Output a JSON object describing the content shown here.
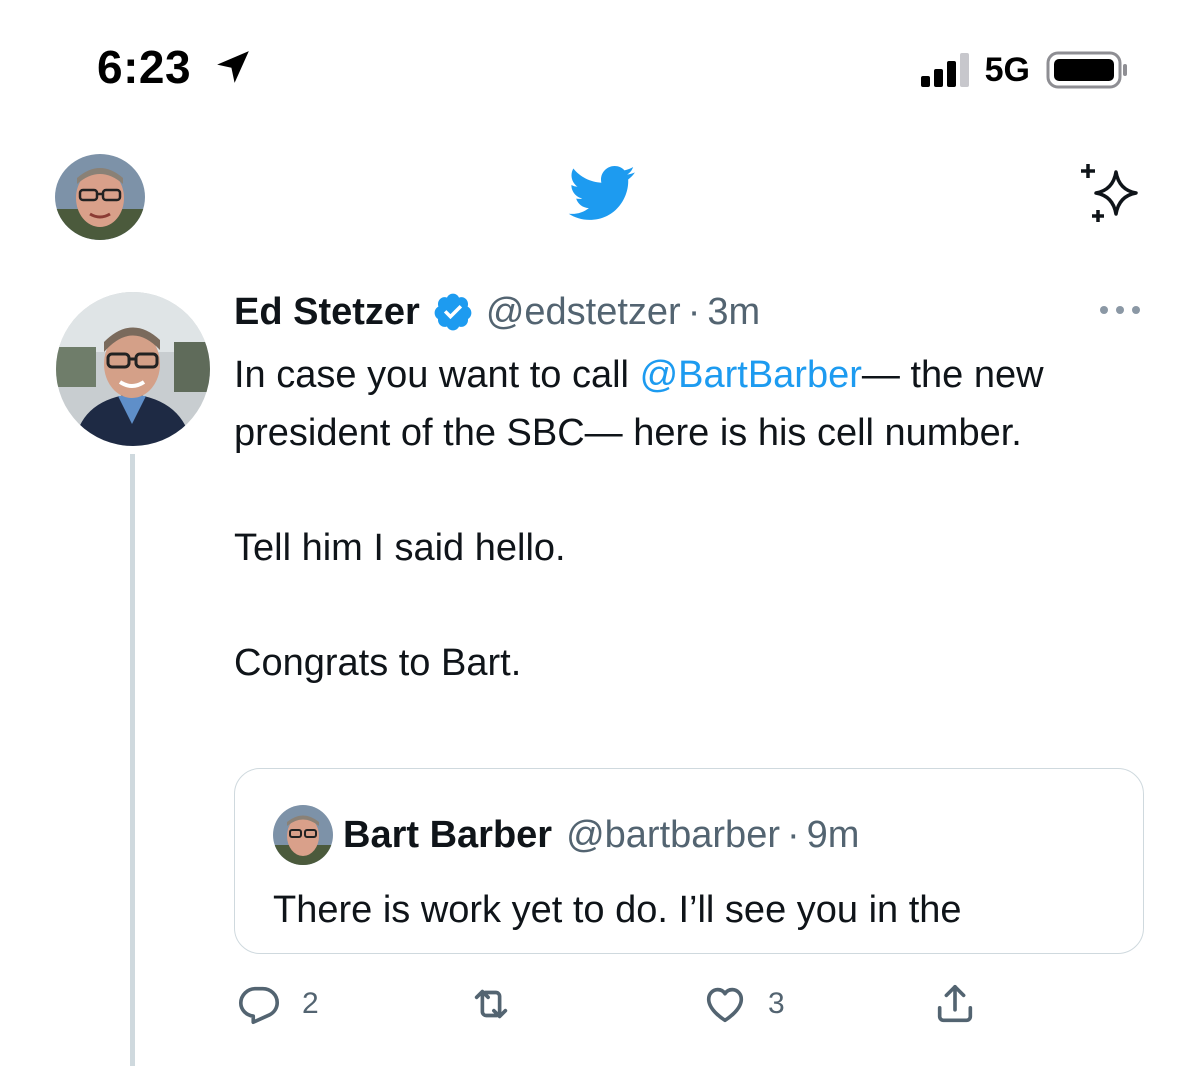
{
  "status_bar": {
    "time": "6:23",
    "network": "5G",
    "icons": [
      "location-arrow-icon",
      "signal-icon",
      "battery-icon"
    ]
  },
  "nav": {
    "icons": [
      "profile-avatar",
      "twitter-bird-icon",
      "sparkle-icon"
    ],
    "accent": "#1d9bf0"
  },
  "tweet": {
    "author_name": "Ed Stetzer",
    "handle": "@edstetzer",
    "separator": "·",
    "time": "3m",
    "text_line1_before": "In case you want to call ",
    "mention": "@BartBarber",
    "text_line1_after": "— the new president of the SBC— here is his cell number.",
    "text_para2": "Tell him I said hello.",
    "text_para3": "Congrats to Bart.",
    "quoted": {
      "author_name": "Bart Barber",
      "handle": "@bartbarber",
      "separator": "·",
      "time": "9m",
      "text": "There is work yet to do. I’ll see you in the"
    },
    "actions": {
      "reply_count": "2",
      "retweet_count": "",
      "like_count": "3"
    }
  },
  "colors": {
    "accent": "#1d9bf0",
    "secondary_text": "#536471",
    "border": "#cfd9de"
  }
}
